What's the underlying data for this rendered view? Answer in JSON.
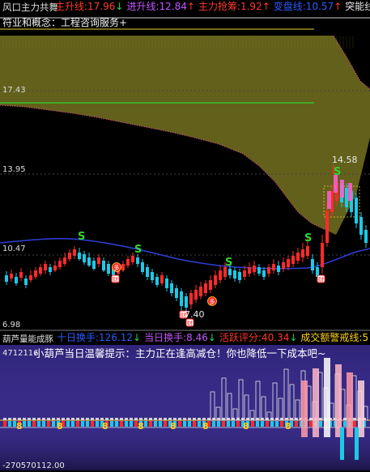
{
  "top_panel": {
    "indicator_name": "风口主力共舞",
    "stats": [
      {
        "label": "主升线:",
        "value": "17.96",
        "arrow": "↓",
        "color": "#ff3a2a",
        "arrow_color": "#2bd649"
      },
      {
        "label": "进升线:",
        "value": "12.84",
        "arrow": "↑",
        "color": "#c455ff",
        "arrow_color": "#ff3a2a"
      },
      {
        "label": "主力抢筹:",
        "value": "1.92",
        "arrow": "↑",
        "color": "#ff3a2a",
        "arrow_color": "#ff3a2a"
      },
      {
        "label": "变盘线:",
        "value": "10.57",
        "arrow": "↑",
        "color": "#2d5bff",
        "arrow_color": "#ff3a2a"
      },
      {
        "label": "突能线",
        "value": "",
        "arrow": "",
        "color": "#e8e8e8",
        "arrow_color": "#e8e8e8"
      }
    ],
    "industry_text": "符业和概念：工程咨询服务+",
    "price_labels": [
      "17.43",
      "13.95",
      "10.47",
      "6.98"
    ],
    "high_label": "14.58",
    "low_label": "7.40",
    "signal_s": "S",
    "cai_label": "财",
    "duo_label": "多"
  },
  "bottom_panel": {
    "indicator_name": "葫芦量能成豚",
    "stats": [
      {
        "label": "十日换手:",
        "value": "126.12",
        "arrow": "↓",
        "color": "#2d5bff",
        "arrow_color": "#2bd649"
      },
      {
        "label": "当日换手:",
        "value": "8.46",
        "arrow": "↓",
        "color": "#c455ff",
        "arrow_color": "#2bd649"
      },
      {
        "label": "活跃评分:",
        "value": "40.34",
        "arrow": "↓",
        "color": "#ff3a2a",
        "arrow_color": "#2bd649"
      },
      {
        "label": "成交额警戒线:",
        "value": "5",
        "arrow": "",
        "color": "#ffd21a",
        "arrow_color": "#ffd21a"
      }
    ],
    "top_value": "4712116",
    "tip_text": "小葫芦当日温馨提示：主力正在逢高减仓！你也降低一下成本吧~",
    "bottom_value": "-270570112.00",
    "gourd_glyph": "8"
  },
  "colors": {
    "up": "#ff2a2a",
    "down": "#1ec8e6",
    "cloud": "#6e6a1e",
    "ma": "#2f3fd8",
    "green_line": "#2fd62f",
    "vol_bg": "#3b2f8f"
  }
}
